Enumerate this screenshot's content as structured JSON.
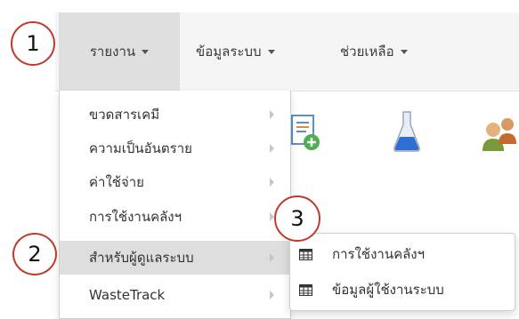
{
  "navbar": {
    "items": [
      {
        "label": "รายงาน"
      },
      {
        "label": "ข้อมูลระบบ"
      },
      {
        "label": "ช่วยเหลือ"
      }
    ]
  },
  "dropdown": {
    "items": [
      {
        "label": "ขวดสารเคมี"
      },
      {
        "label": "ความเป็นอันตราย"
      },
      {
        "label": "ค่าใช้จ่าย"
      },
      {
        "label": "การใช้งานคลังฯ"
      },
      {
        "label": "สำหรับผู้ดูแลระบบ"
      },
      {
        "label": "WasteTrack"
      }
    ]
  },
  "submenu": {
    "items": [
      {
        "label": "การใช้งานคลังฯ",
        "icon": "table-icon"
      },
      {
        "label": "ข้อมูลผู้ใช้งานระบบ",
        "icon": "table-icon"
      }
    ]
  },
  "annotations": {
    "badge_1": "1",
    "badge_2": "2",
    "badge_3": "3"
  },
  "toolbar_icons": [
    "document-add-icon",
    "flask-icon",
    "users-icon"
  ],
  "colors": {
    "navbar_bg": "#f5f5f5",
    "active_item_bg": "#dedede",
    "badge_border": "#c0392b"
  }
}
